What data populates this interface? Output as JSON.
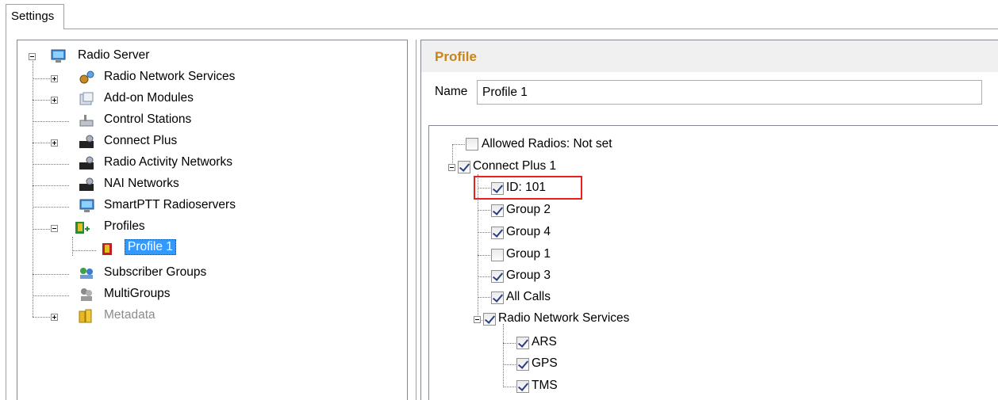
{
  "tab": {
    "label": "Settings"
  },
  "left_tree": {
    "root": "Radio Server",
    "items": [
      {
        "label": "Radio Network Services"
      },
      {
        "label": "Add-on Modules"
      },
      {
        "label": "Control Stations"
      },
      {
        "label": "Connect Plus"
      },
      {
        "label": "Radio Activity Networks"
      },
      {
        "label": "NAI Networks"
      },
      {
        "label": "SmartPTT Radioservers"
      },
      {
        "label": "Profiles"
      },
      {
        "label": "Profile 1"
      },
      {
        "label": "Subscriber Groups"
      },
      {
        "label": "MultiGroups"
      },
      {
        "label": "Metadata"
      }
    ]
  },
  "profile": {
    "title": "Profile",
    "name_label": "Name",
    "name_value": "Profile 1"
  },
  "right_tree": {
    "items": [
      {
        "label": "Allowed Radios: Not set",
        "checked": false
      },
      {
        "label": "Connect Plus 1",
        "checked": true
      },
      {
        "label": "ID: 101",
        "checked": true
      },
      {
        "label": "Group 2",
        "checked": true
      },
      {
        "label": "Group 4",
        "checked": true
      },
      {
        "label": "Group 1",
        "checked": false
      },
      {
        "label": "Group 3",
        "checked": true
      },
      {
        "label": "All Calls",
        "checked": true
      },
      {
        "label": "Radio Network Services",
        "checked": true
      },
      {
        "label": "ARS",
        "checked": true
      },
      {
        "label": "GPS",
        "checked": true
      },
      {
        "label": "TMS",
        "checked": true
      }
    ]
  },
  "colors": {
    "accent_title": "#c8841c",
    "selection": "#3399ff",
    "highlight_box": "#e8201f"
  }
}
